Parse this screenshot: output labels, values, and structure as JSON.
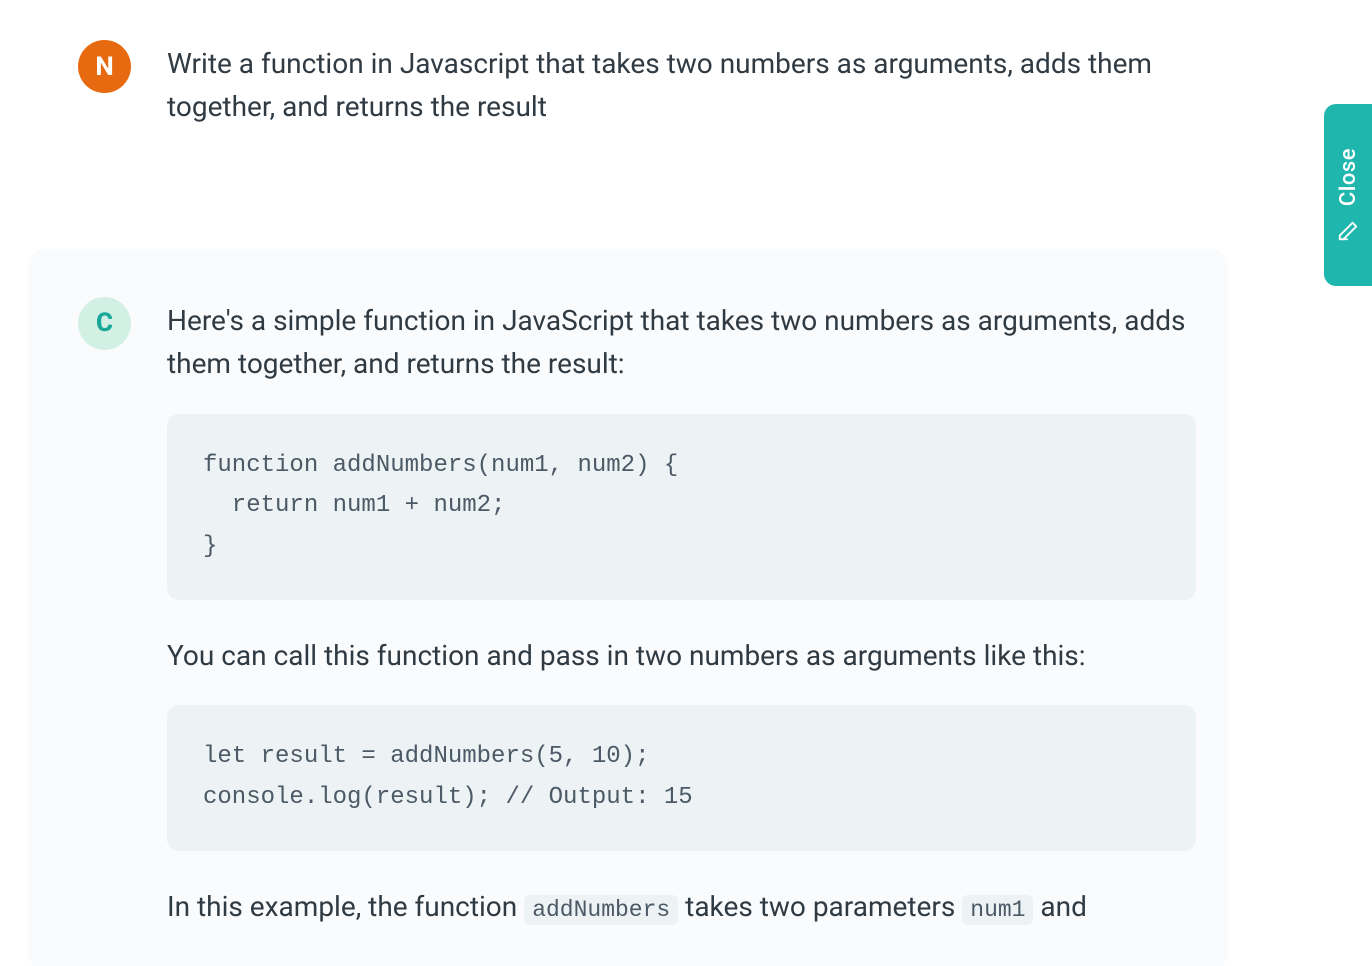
{
  "close_button": {
    "label": "Close"
  },
  "user": {
    "avatar_letter": "N",
    "message": "Write a function in Javascript that takes two numbers as arguments, adds them together, and returns the result"
  },
  "assistant": {
    "avatar_letter": "C",
    "paragraph_1": "Here's a simple function in JavaScript that takes two numbers as arguments, adds them together, and returns the result:",
    "code_block_1": "function addNumbers(num1, num2) {\n  return num1 + num2;\n}",
    "paragraph_2": "You can call this function and pass in two numbers as arguments like this:",
    "code_block_2": "let result = addNumbers(5, 10);\nconsole.log(result); // Output: 15",
    "paragraph_3_pre": "In this example, the function ",
    "paragraph_3_code1": "addNumbers",
    "paragraph_3_mid": " takes two parameters ",
    "paragraph_3_code2": "num1",
    "paragraph_3_post": " and"
  }
}
